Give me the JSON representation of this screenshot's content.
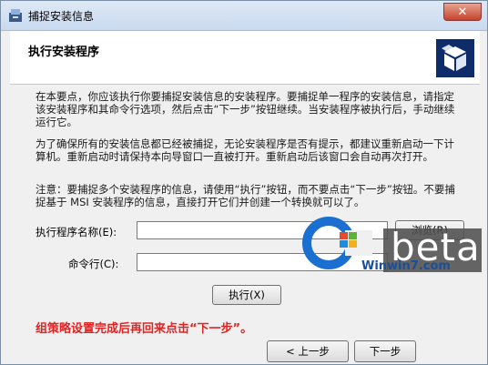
{
  "window": {
    "title": "捕捉安装信息",
    "close_label": "✕"
  },
  "header": {
    "title": "执行安装程序",
    "icon": "installer-box-icon"
  },
  "instructions": {
    "p1": "在本要点，你应该执行你要捕捉安装信息的安装程序。要捕捉单一程序的安装信息，请指定该安装程序和其命令行选项，然后点击“下一步”按钮继续。当安装程序被执行后，手动继续运行它。",
    "p2": "为了确保所有的安装信息都已经被捕捉，无论安装程序是否有提示，都建议重新启动一下计算机。重新启动时请保持本向导窗口一直被打开。重新启动后该窗口会自动再次打开。",
    "p3": "注意：要捕捉多个安装程序的信息，请使用“执行”按钮，而不要点击“下一步”按钮。不要捕捉基于 MSI 安装程序的信息，直接打开它们并创建一个转换就可以了。"
  },
  "form": {
    "program_label": "执行程序名称(E):",
    "program_value": "",
    "browse_label": "浏览(R)",
    "cmdline_label": "命令行(C):",
    "cmdline_value": "",
    "execute_label": "执行(X)"
  },
  "note": "组策略设置完成后再回来点击“下一步”。",
  "footer": {
    "back_label": "< 上一步",
    "next_label": "下一步"
  },
  "watermark": {
    "text": "beta",
    "url": "Winwin7.com",
    "brand_color": "#1a6fd1"
  }
}
